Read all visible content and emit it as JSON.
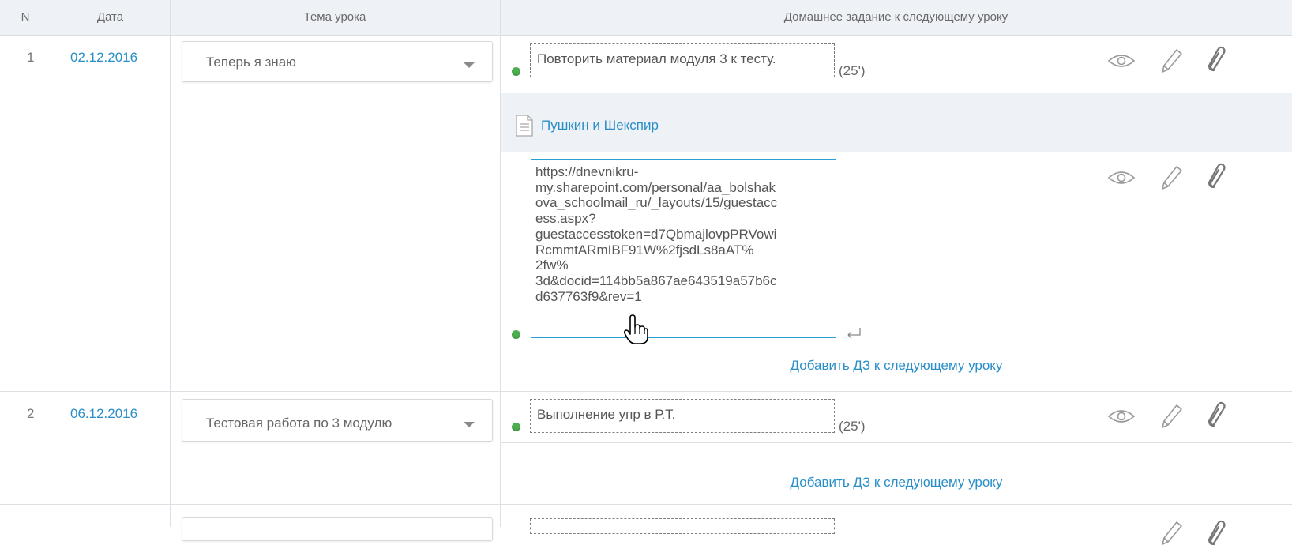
{
  "table": {
    "headers": {
      "n": "N",
      "date": "Дата",
      "topic": "Тема урока",
      "homework": "Домашнее задание к следующему уроку"
    }
  },
  "lessons": [
    {
      "n": "1",
      "date": "02.12.2016",
      "topic": "Теперь я знаю",
      "homework": [
        {
          "text": "Повторить материал модуля 3 к тесту.",
          "duration": "(25')"
        }
      ],
      "attachment": "Пушкин и Шекспир",
      "editing_text": "https://dnevnikru-my.sharepoint.com/personal/aa_bolshakova_schoolmail_ru/_layouts/15/guestaccess.aspx?guestaccesstoken=d7QbmajlovpPRVowiRcmmtARmIBF91W%2fjsdLs8aAT%2fw%3d&docid=114bb5a867ae643519a57b6cd637763f9&rev=1",
      "editing_lines": [
        "https://dnevnikru-",
        "my.sharepoint.com/personal/aa_bolshak",
        "ova_schoolmail_ru/_layouts/15/guestacc",
        "ess.aspx?",
        "guestaccesstoken=d7QbmajlovpPRVowi",
        "RcmmtARmIBF91W%2fjsdLs8aAT%",
        "2fw%",
        "3d&docid=114bb5a867ae643519a57b6c",
        "d637763f9&rev=1"
      ],
      "add_link": "Добавить ДЗ к следующему уроку"
    },
    {
      "n": "2",
      "date": "06.12.2016",
      "topic": "Тестовая работа по 3 модулю",
      "homework": [
        {
          "text": "Выполнение упр в Р.Т.",
          "duration": "(25')"
        }
      ],
      "add_link": "Добавить ДЗ к следующему уроку"
    }
  ],
  "icons": {
    "view": "eye-icon",
    "edit": "pencil-icon",
    "attach": "paperclip-icon",
    "enter": "return-icon",
    "document": "document-icon",
    "dropdown": "chevron-down-icon",
    "cursor": "hand-pointer-icon"
  },
  "colors": {
    "link": "#2a8fc8",
    "header_bg": "#eef2f7",
    "status_dot": "#4caf50",
    "focus_border": "#2a9fd6"
  }
}
